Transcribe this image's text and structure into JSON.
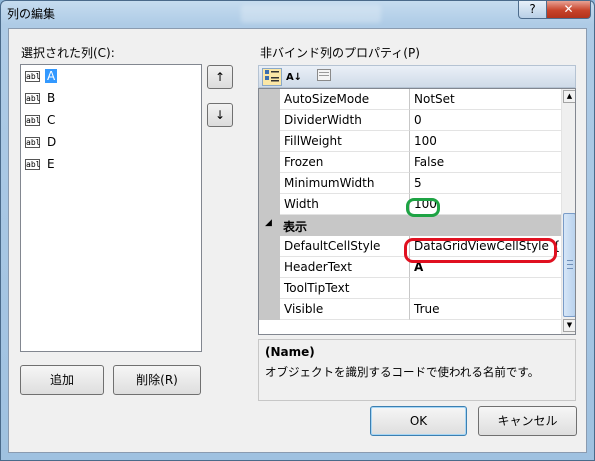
{
  "window": {
    "title": "列の編集",
    "help_glyph": "?",
    "close_glyph": "✕"
  },
  "left": {
    "label": "選択された列(C):",
    "icon_text": "abl",
    "columns": [
      {
        "name": "A",
        "selected": true
      },
      {
        "name": "B",
        "selected": false
      },
      {
        "name": "C",
        "selected": false
      },
      {
        "name": "D",
        "selected": false
      },
      {
        "name": "E",
        "selected": false
      }
    ],
    "move_up_glyph": "↑",
    "move_down_glyph": "↓",
    "add_label": "追加",
    "remove_label": "削除(R)"
  },
  "right": {
    "label": "非バインド列のプロパティ(P)",
    "toolbar": {
      "categorized_icon": "categorized-icon",
      "alphabetical_glyph": "A↓",
      "pages_icon": "property-pages-icon"
    },
    "properties": [
      {
        "name": "AutoSizeMode",
        "value": "NotSet"
      },
      {
        "name": "DividerWidth",
        "value": "0"
      },
      {
        "name": "FillWeight",
        "value": "100"
      },
      {
        "name": "Frozen",
        "value": "False"
      },
      {
        "name": "MinimumWidth",
        "value": "5"
      },
      {
        "name": "Width",
        "value": "100"
      }
    ],
    "category": {
      "toggle": "◢",
      "label": "表示"
    },
    "display_properties": [
      {
        "name": "DefaultCellStyle",
        "value": "DataGridViewCellStyle {"
      },
      {
        "name": "HeaderText",
        "value": "A"
      },
      {
        "name": "ToolTipText",
        "value": ""
      },
      {
        "name": "Visible",
        "value": "True"
      }
    ],
    "description": {
      "title": "(Name)",
      "text": "オブジェクトを識別するコードで使われる名前です。"
    }
  },
  "footer": {
    "ok_label": "OK",
    "cancel_label": "キャンセル"
  },
  "colors": {
    "selection": "#3399ff",
    "annotation_green": "#1ea344",
    "annotation_red": "#e01020"
  }
}
